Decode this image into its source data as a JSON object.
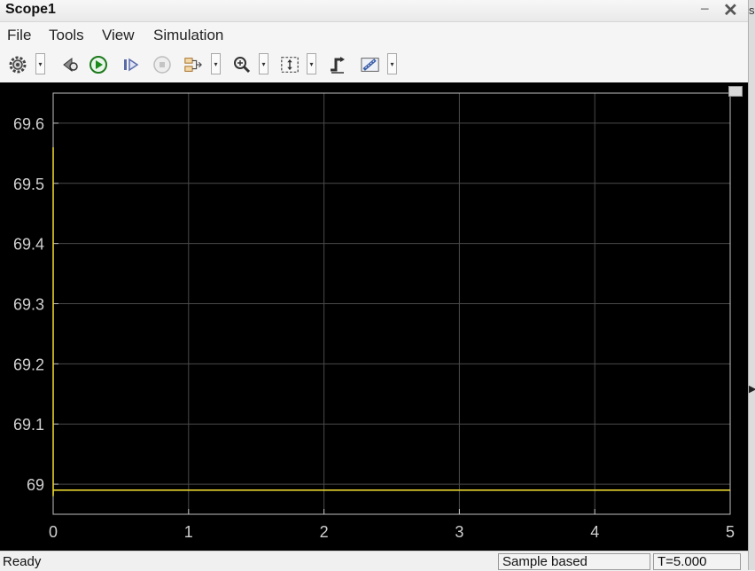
{
  "window": {
    "title": "Scope1",
    "minimize_glyph": "−",
    "close_glyph": "✕"
  },
  "right_strip": {
    "letter": "s",
    "arrow": "▶"
  },
  "menu": {
    "items": [
      "File",
      "Tools",
      "View",
      "Simulation"
    ]
  },
  "toolbar": {
    "icons": [
      "settings-icon",
      "dropdown-arrow",
      "step-back-icon",
      "run-icon",
      "step-forward-icon",
      "stop-icon",
      "signal-selector-icon",
      "dropdown-arrow",
      "zoom-in-icon",
      "dropdown-arrow",
      "scale-axes-icon",
      "dropdown-arrow",
      "triggers-icon",
      "measurements-icon",
      "dropdown-arrow"
    ]
  },
  "colors": {
    "plot_background": "#000000",
    "grid": "#4a4a4a",
    "axis_text": "#d0d0d0",
    "signal": "#e6d22e"
  },
  "chart_data": {
    "type": "line",
    "series": [
      {
        "x": [
          0,
          0,
          0.001,
          5
        ],
        "y": [
          69.56,
          68.98,
          68.99,
          68.99
        ]
      }
    ],
    "xlim": [
      0,
      5
    ],
    "ylim": [
      68.95,
      69.65
    ],
    "xticks": [
      0,
      1,
      2,
      3,
      4,
      5
    ],
    "yticks": [
      69,
      69.1,
      69.2,
      69.3,
      69.4,
      69.5,
      69.6
    ],
    "xtick_labels": [
      "0",
      "1",
      "2",
      "3",
      "4",
      "5"
    ],
    "ytick_labels": [
      "69",
      "69.1",
      "69.2",
      "69.3",
      "69.4",
      "69.5",
      "69.6"
    ],
    "grid": true,
    "title": "",
    "xlabel": "",
    "ylabel": ""
  },
  "status": {
    "ready": "Ready",
    "mode": "Sample based",
    "time": "T=5.000"
  }
}
